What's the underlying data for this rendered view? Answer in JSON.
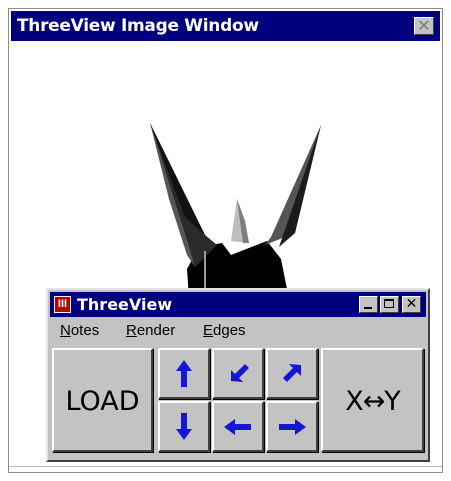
{
  "image_window": {
    "title": "ThreeView Image Window",
    "close_glyph": "✕"
  },
  "threeview": {
    "title": "ThreeView",
    "icon_glyph": "III",
    "close_glyph": "✕",
    "title_bar_color": "#00007e",
    "menu": [
      {
        "label": "Notes",
        "accel": "N",
        "rest": "otes"
      },
      {
        "label": "Render",
        "accel": "R",
        "rest": "ender"
      },
      {
        "label": "Edges",
        "accel": "E",
        "rest": "dges"
      }
    ],
    "toolbar": {
      "load_label": "LOAD",
      "swap_label": "X↔Y",
      "arrow_color": "#1515d6",
      "arrows": [
        {
          "name": "arrow-up-icon",
          "direction": "up"
        },
        {
          "name": "arrow-down-left-icon",
          "direction": "down-left"
        },
        {
          "name": "arrow-up-right-icon",
          "direction": "up-right"
        },
        {
          "name": "arrow-down-icon",
          "direction": "down"
        },
        {
          "name": "arrow-left-icon",
          "direction": "left"
        },
        {
          "name": "arrow-right-icon",
          "direction": "right"
        }
      ]
    }
  }
}
